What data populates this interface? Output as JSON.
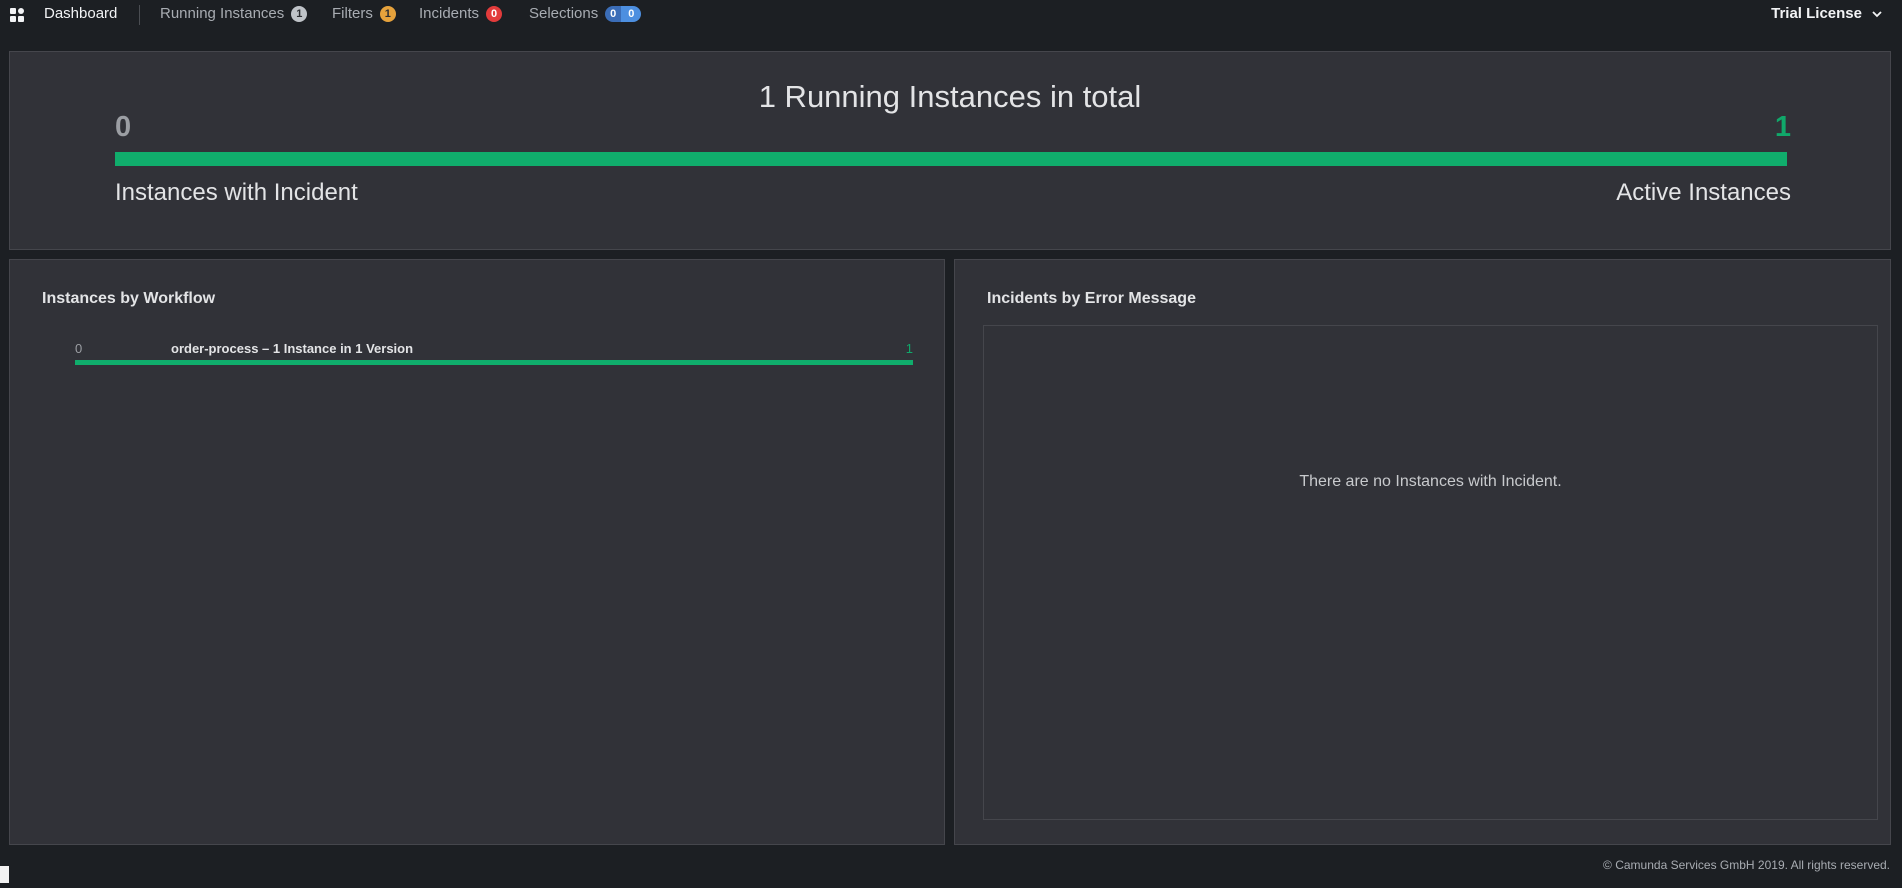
{
  "header": {
    "dashboard_label": "Dashboard",
    "running_instances_label": "Running Instances",
    "running_instances_count": "1",
    "filters_label": "Filters",
    "filters_count": "1",
    "incidents_label": "Incidents",
    "incidents_count": "0",
    "selections_label": "Selections",
    "selections_count_a": "0",
    "selections_count_b": "0",
    "license_label": "Trial License"
  },
  "metrics": {
    "title": "1 Running Instances in total",
    "incident_count": "0",
    "active_count": "1",
    "incident_label": "Instances with Incident",
    "active_label": "Active Instances",
    "active_fraction": 1.0
  },
  "workflows": {
    "title": "Instances by Workflow",
    "items": [
      {
        "incidents": "0",
        "name": "order-process – 1 Instance in 1 Version",
        "active": "1",
        "active_fraction": 1.0
      }
    ]
  },
  "incidents_panel": {
    "title": "Incidents by Error Message",
    "empty_message": "There are no Instances with Incident."
  },
  "footer": {
    "copyright": "© Camunda Services GmbH 2019. All rights reserved."
  },
  "colors": {
    "accent_green": "#10ad6c",
    "incident_red": "#e23b3b",
    "filter_orange": "#e6a23c",
    "selection_blue": "#4d8fe0"
  }
}
